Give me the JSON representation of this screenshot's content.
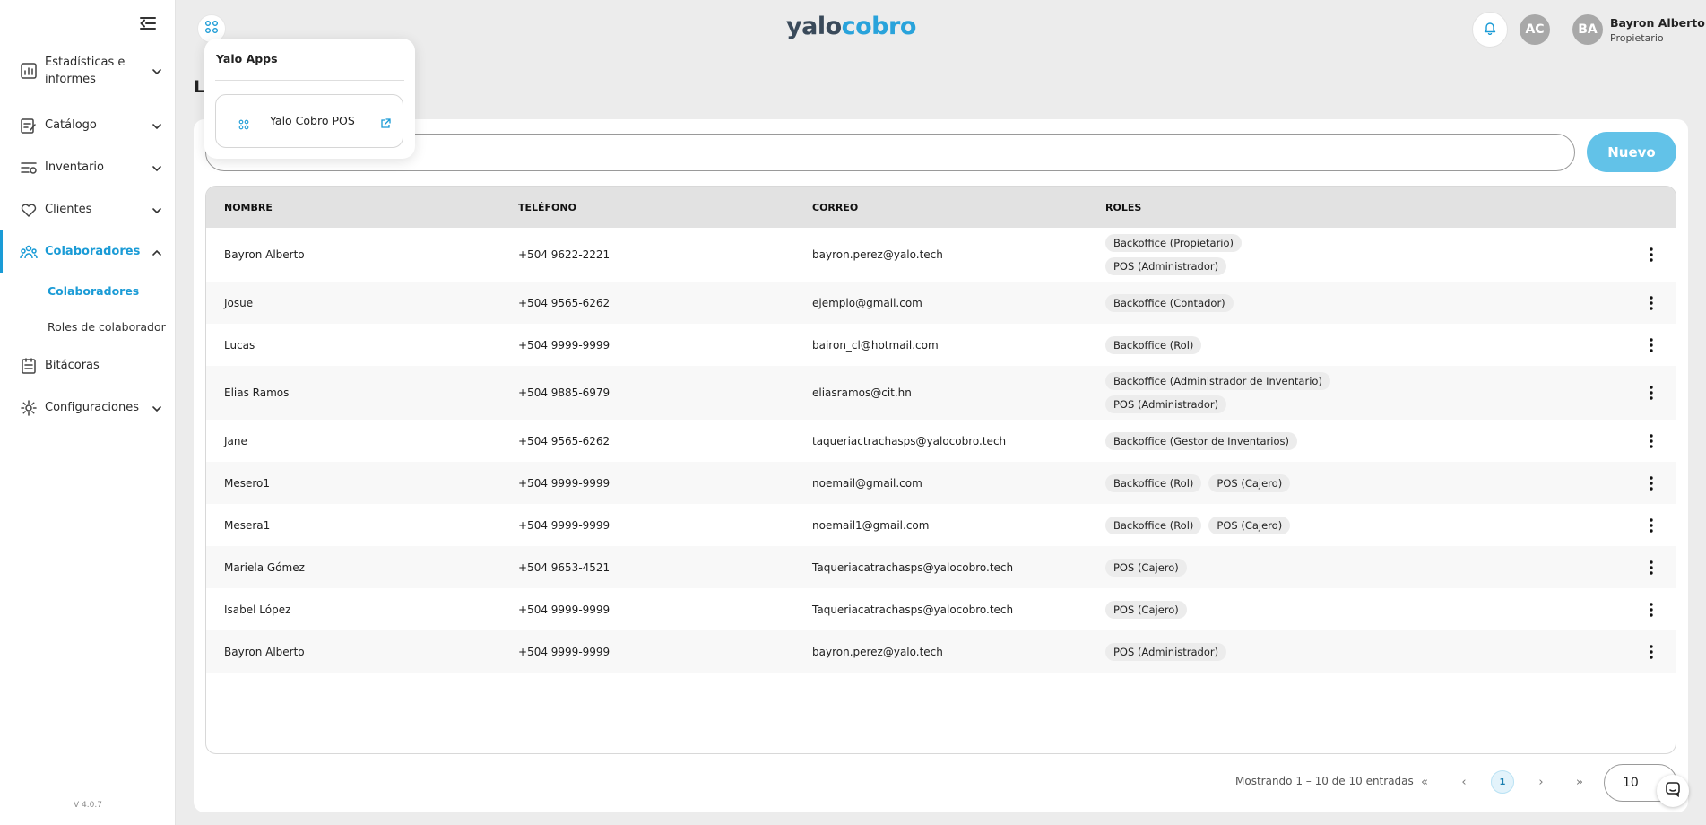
{
  "brand": {
    "logo_part1": "yalo",
    "logo_part2": "cobro",
    "accent": "#1a9bd6"
  },
  "header": {
    "page_title_partial": "L",
    "avatar_initials": "AC",
    "user": {
      "initials": "BA",
      "name": "Bayron Alberto",
      "role": "Propietario"
    }
  },
  "sidebar": {
    "items": [
      {
        "label": "Estadísticas e informes",
        "icon": "chart-icon"
      },
      {
        "label": "Catálogo",
        "icon": "catalog-icon"
      },
      {
        "label": "Inventario",
        "icon": "inventory-icon"
      },
      {
        "label": "Clientes",
        "icon": "clients-icon"
      },
      {
        "label": "Colaboradores",
        "icon": "collaborators-icon"
      },
      {
        "label": "Bitácoras",
        "icon": "logs-icon"
      },
      {
        "label": "Configuraciones",
        "icon": "settings-icon"
      }
    ],
    "sub_items": [
      {
        "label": "Colaboradores"
      },
      {
        "label": "Roles de colaborador"
      }
    ],
    "version": "V 4.0.7"
  },
  "apps_popover": {
    "title": "Yalo Apps",
    "apps": [
      {
        "name": "Yalo Cobro POS"
      }
    ]
  },
  "toolbar": {
    "search_value": "",
    "new_label": "Nuevo"
  },
  "table": {
    "headers": [
      "NOMBRE",
      "TELÉFONO",
      "CORREO",
      "ROLES"
    ],
    "rows": [
      {
        "name": "Bayron Alberto",
        "phone": "+504 9622-2221",
        "email": "bayron.perez@yalo.tech",
        "roles": [
          "Backoffice (Propietario)",
          "POS (Administrador)"
        ]
      },
      {
        "name": "Josue",
        "phone": "+504 9565-6262",
        "email": "ejemplo@gmail.com",
        "roles": [
          "Backoffice (Contador)"
        ]
      },
      {
        "name": "Lucas",
        "phone": "+504 9999-9999",
        "email": "bairon_cl@hotmail.com",
        "roles": [
          "Backoffice (Rol)"
        ]
      },
      {
        "name": "Elias Ramos",
        "phone": "+504 9885-6979",
        "email": "eliasramos@cit.hn",
        "roles": [
          "Backoffice (Administrador de Inventario)",
          "POS (Administrador)"
        ]
      },
      {
        "name": "Jane",
        "phone": "+504 9565-6262",
        "email": "taqueriactrachasps@yalocobro.tech",
        "roles": [
          "Backoffice (Gestor de Inventarios)"
        ]
      },
      {
        "name": "Mesero1",
        "phone": "+504 9999-9999",
        "email": "noemail@gmail.com",
        "roles": [
          "Backoffice (Rol)",
          "POS (Cajero)"
        ]
      },
      {
        "name": "Mesera1",
        "phone": "+504 9999-9999",
        "email": "noemail1@gmail.com",
        "roles": [
          "Backoffice (Rol)",
          "POS (Cajero)"
        ]
      },
      {
        "name": "Mariela Gómez",
        "phone": "+504 9653-4521",
        "email": "Taqueriacatrachasps@yalocobro.tech",
        "roles": [
          "POS (Cajero)"
        ]
      },
      {
        "name": "Isabel López",
        "phone": "+504 9999-9999",
        "email": "Taqueriacatrachasps@yalocobro.tech",
        "roles": [
          "POS (Cajero)"
        ]
      },
      {
        "name": "Bayron Alberto",
        "phone": "+504 9999-9999",
        "email": "bayron.perez@yalo.tech",
        "roles": [
          "POS (Administrador)"
        ]
      }
    ]
  },
  "pagination": {
    "summary": "Mostrando 1 – 10 de 10 entradas",
    "first": "«",
    "prev": "‹",
    "current": "1",
    "next": "›",
    "last": "»",
    "page_size": "10"
  }
}
